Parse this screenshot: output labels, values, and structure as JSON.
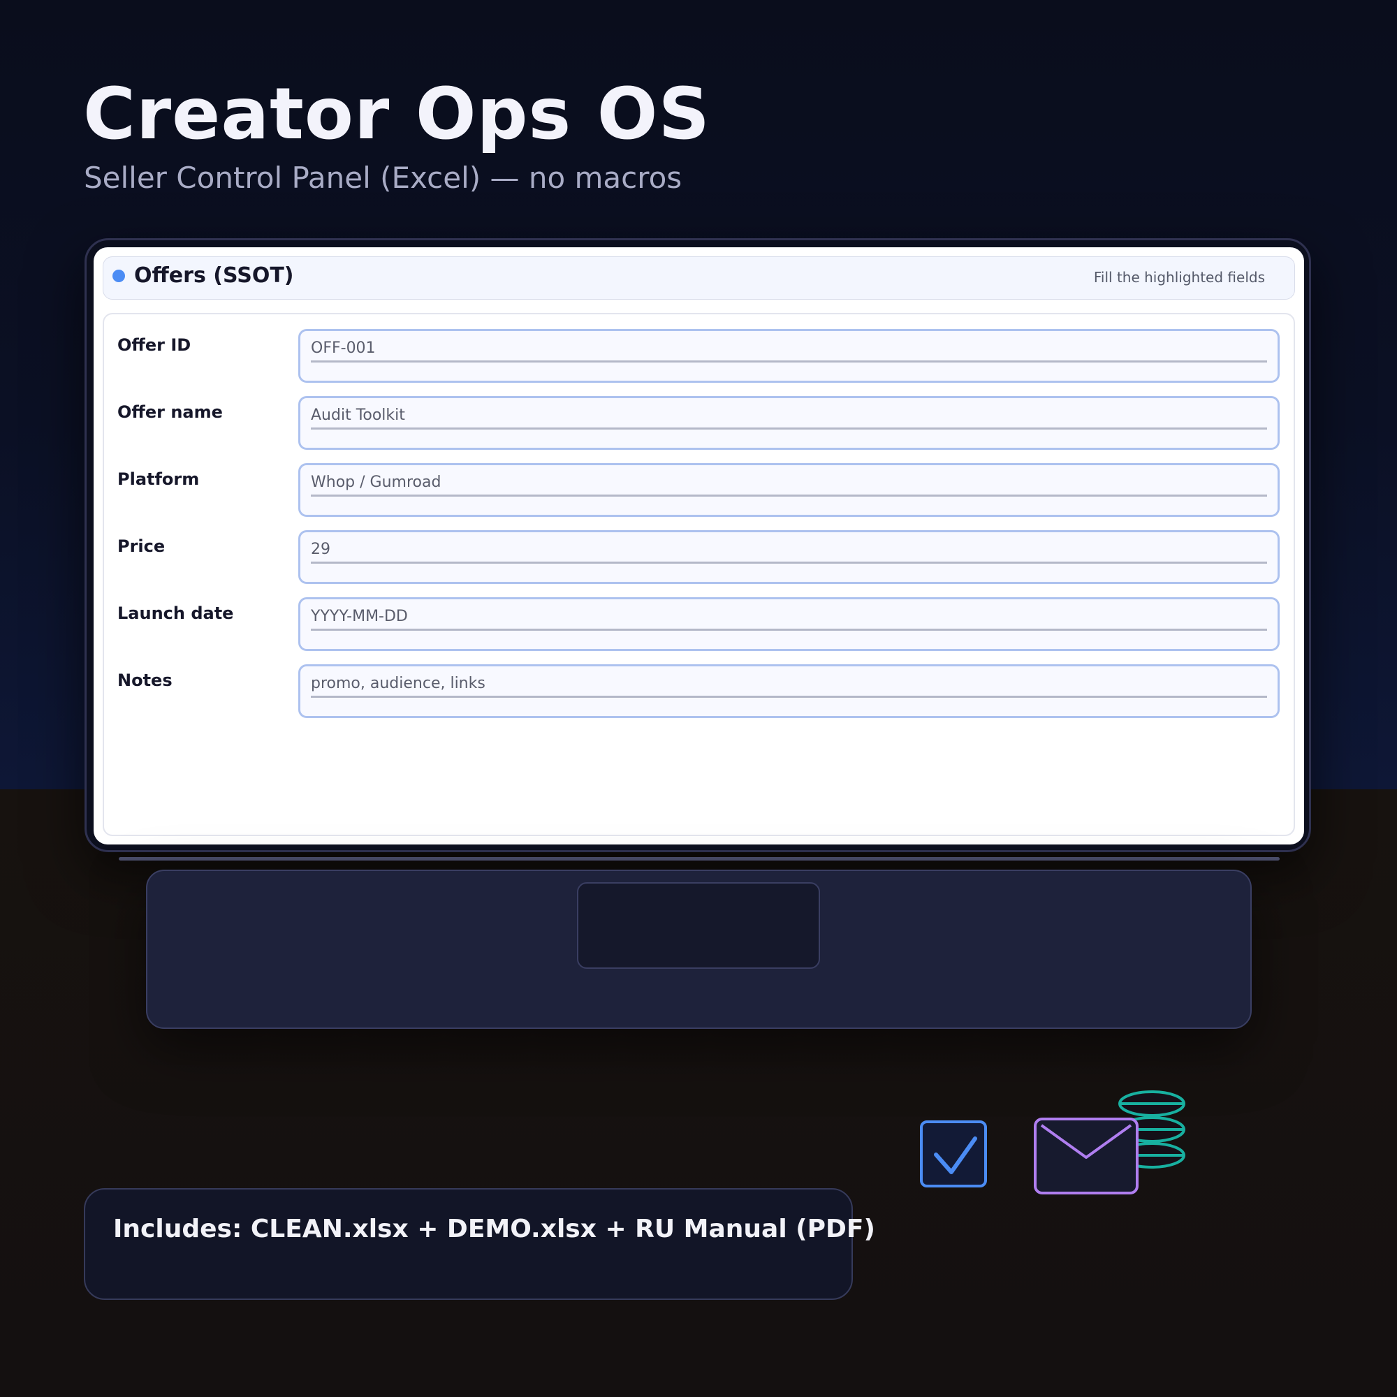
{
  "hero": {
    "title": "Creator Ops OS",
    "subtitle": "Seller Control Panel (Excel) — no macros"
  },
  "panel": {
    "title": "Offers (SSOT)",
    "hint": "Fill the highlighted fields"
  },
  "fields": [
    {
      "label": "Offer ID",
      "value": "OFF-001"
    },
    {
      "label": "Offer name",
      "value": "Audit Toolkit"
    },
    {
      "label": "Platform",
      "value": "Whop / Gumroad"
    },
    {
      "label": "Price",
      "value": "29"
    },
    {
      "label": "Launch date",
      "value": "YYYY-MM-DD"
    },
    {
      "label": "Notes",
      "value": "promo, audience, links"
    }
  ],
  "includes": {
    "text": "Includes: CLEAN.xlsx + DEMO.xlsx + RU Manual (PDF)"
  },
  "icons": [
    {
      "name": "checkbox-icon",
      "color": "#4b8cf4"
    },
    {
      "name": "envelope-icon",
      "color": "#b07ef0"
    },
    {
      "name": "coin-stack-icon",
      "color": "#18b0a0"
    }
  ],
  "colors": {
    "accent": "#4b8cf4",
    "field_border": "#adc2ef",
    "background_top": "#0a0d1c",
    "floor": "#17120f"
  }
}
